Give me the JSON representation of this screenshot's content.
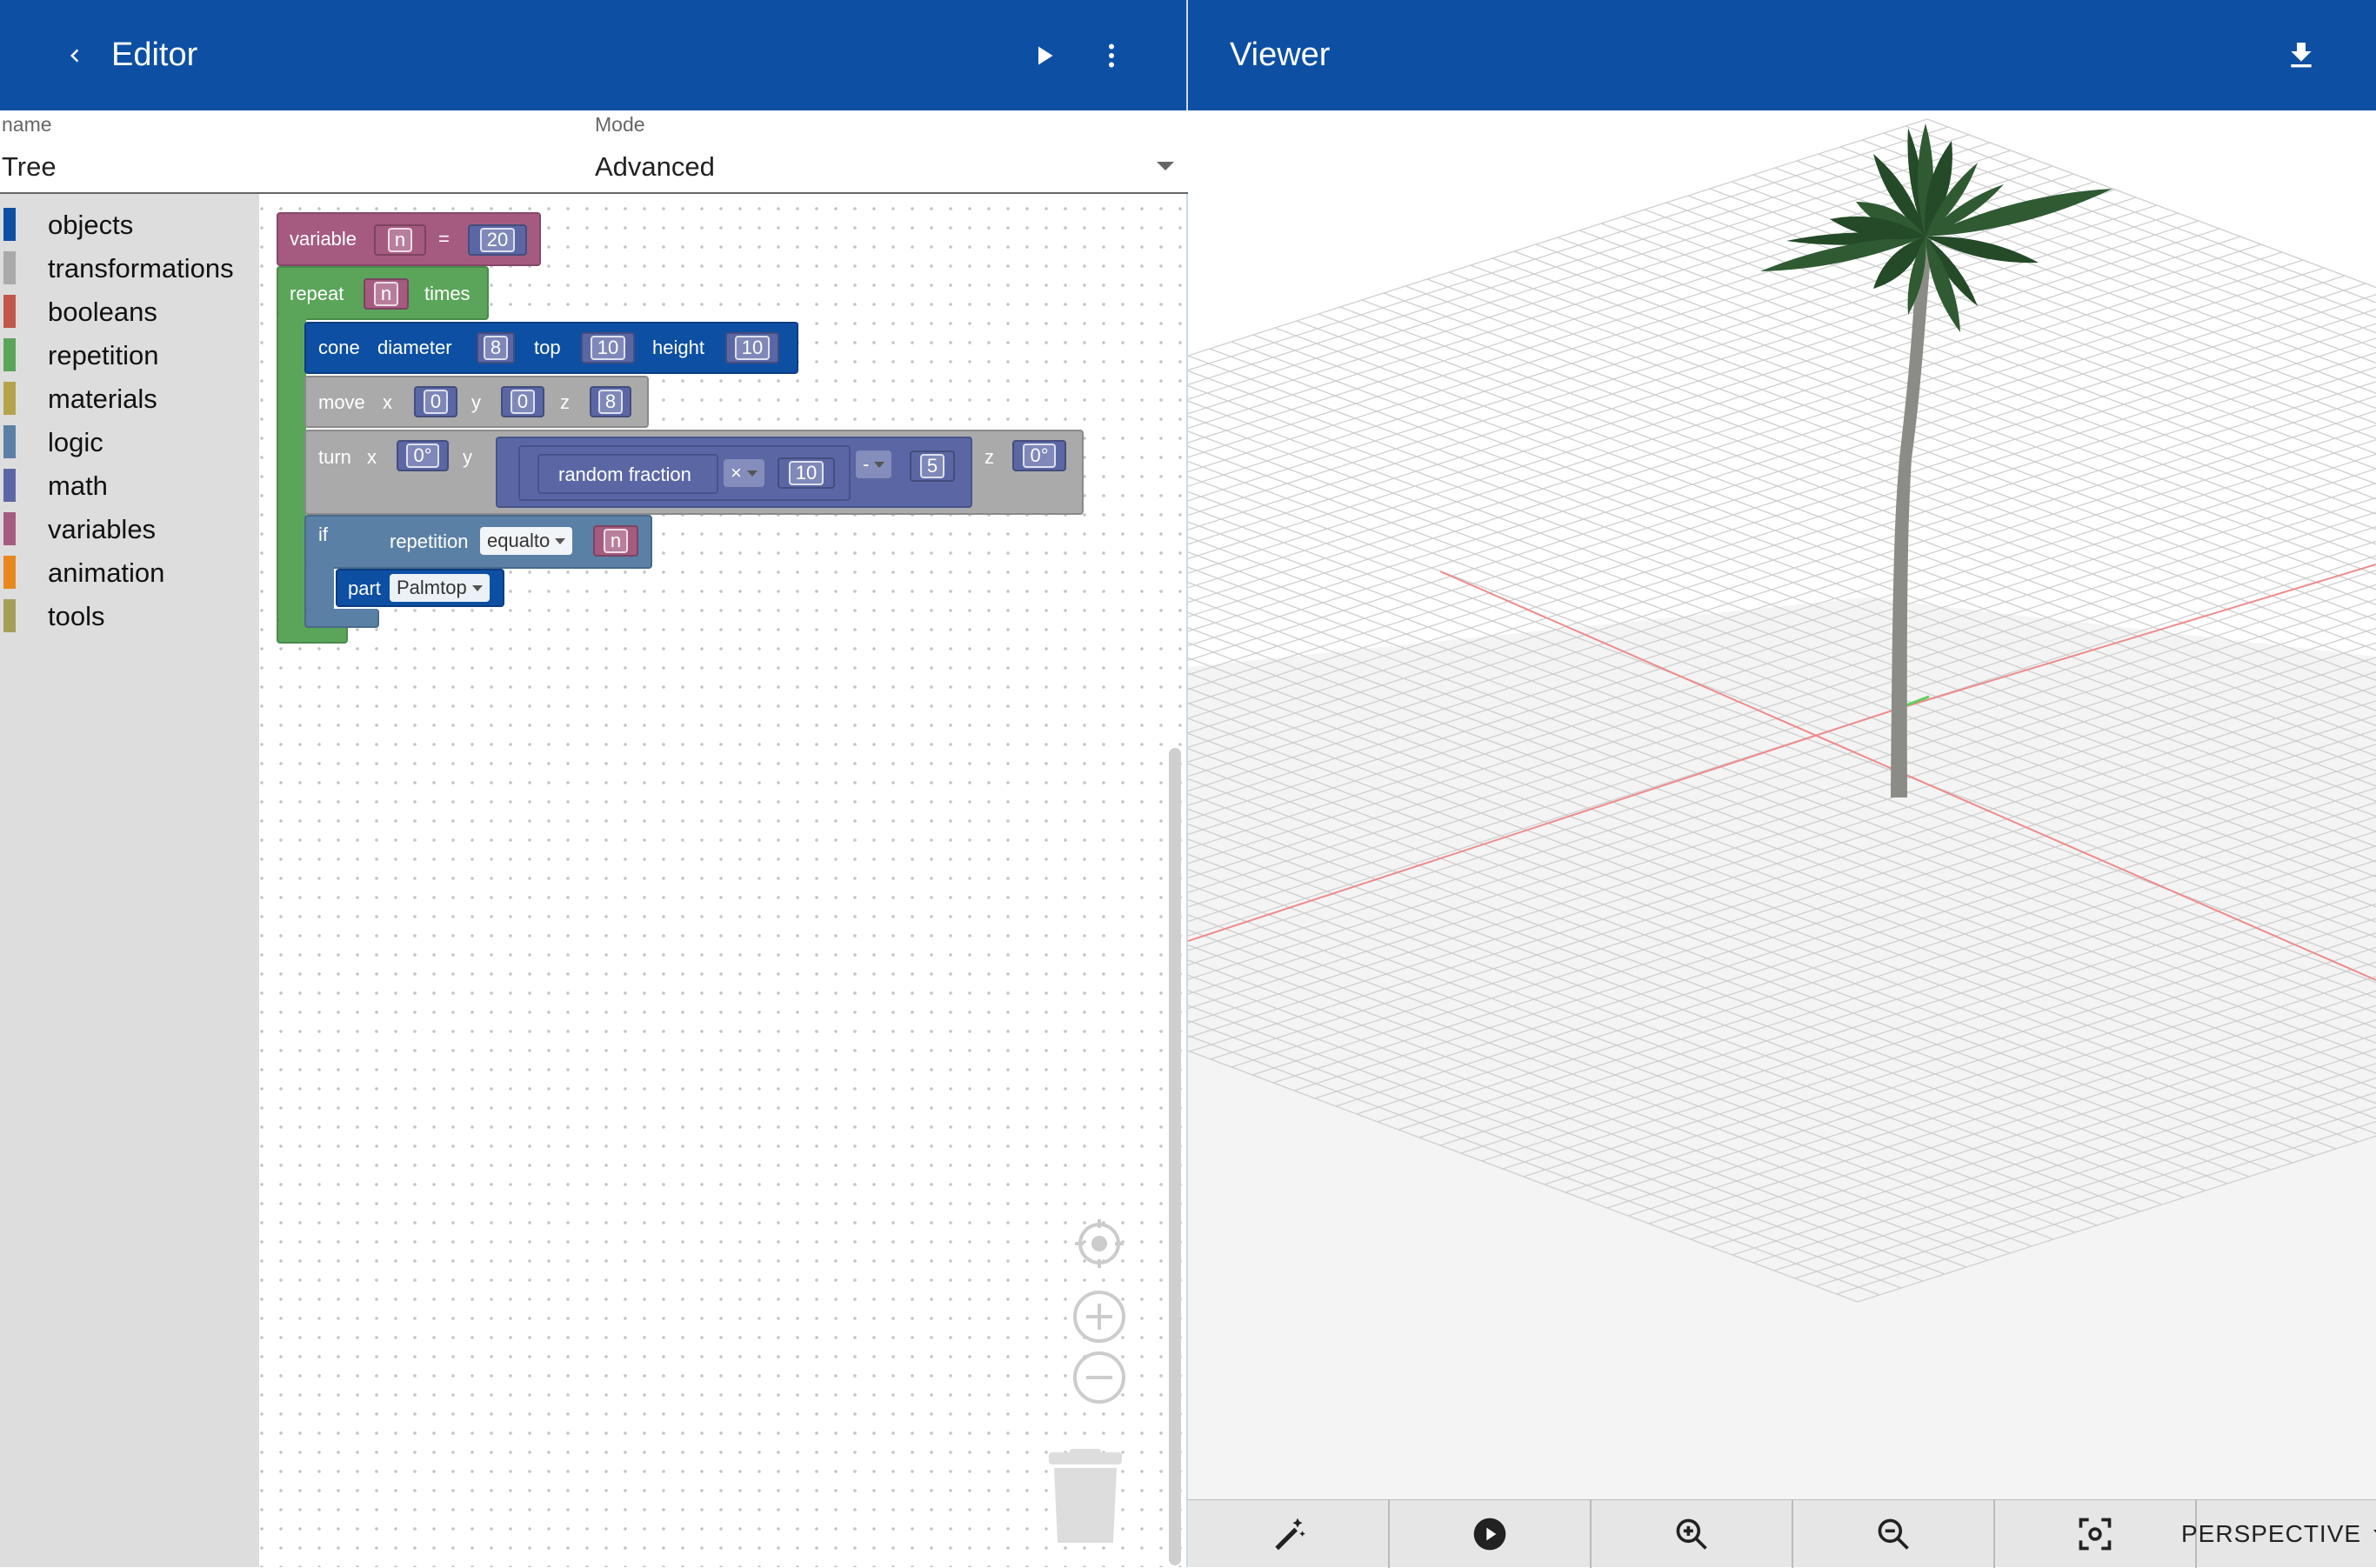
{
  "editor": {
    "back_icon": "chevron-left-icon",
    "title": "Editor",
    "run_icon": "play-icon",
    "menu_icon": "more-vert-icon"
  },
  "viewer": {
    "title": "Viewer",
    "download_icon": "download-icon"
  },
  "name_field": {
    "label": "name",
    "value": "Tree"
  },
  "mode_field": {
    "label": "Mode",
    "value": "Advanced"
  },
  "toolbox": {
    "categories": [
      {
        "label": "objects",
        "color": "#0d4fa3"
      },
      {
        "label": "transformations",
        "color": "#aaaaaa"
      },
      {
        "label": "booleans",
        "color": "#c1574a"
      },
      {
        "label": "repetition",
        "color": "#5ba55b"
      },
      {
        "label": "materials",
        "color": "#b5a34b"
      },
      {
        "label": "logic",
        "color": "#5b80a5"
      },
      {
        "label": "math",
        "color": "#5b67a5"
      },
      {
        "label": "variables",
        "color": "#a55b80"
      },
      {
        "label": "animation",
        "color": "#e9861d"
      },
      {
        "label": "tools",
        "color": "#a59e5b"
      }
    ]
  },
  "blocks": {
    "variable": {
      "keyword": "variable",
      "name": "n",
      "eq": "=",
      "value": "20"
    },
    "repeat": {
      "keyword": "repeat",
      "count": "n",
      "suffix": "times"
    },
    "cone": {
      "keyword": "cone",
      "diameter_label": "diameter",
      "diameter": "8",
      "top_label": "top",
      "top": "10",
      "height_label": "height",
      "height": "10"
    },
    "move": {
      "keyword": "move",
      "x_label": "x",
      "x": "0",
      "y_label": "y",
      "y": "0",
      "z_label": "z",
      "z": "8"
    },
    "turn": {
      "keyword": "turn",
      "x_label": "x",
      "x": "0°",
      "y_label": "y",
      "random": "random fraction",
      "op1": "×",
      "v1": "10",
      "op2": "-",
      "v2": "5",
      "z_label": "z",
      "z": "0°"
    },
    "if": {
      "keyword": "if",
      "repetition": "repetition",
      "cmp": "equalto",
      "var": "n"
    },
    "part": {
      "keyword": "part",
      "name": "Palmtop"
    }
  },
  "workspace_controls": {
    "center_icon": "recenter-icon",
    "zoom_in_icon": "zoom-in-icon",
    "zoom_out_icon": "zoom-out-icon",
    "trash_icon": "trash-icon"
  },
  "viewer_toolbar": {
    "tools": [
      "magic-wand-icon",
      "play-circle-icon",
      "zoom-in-icon",
      "zoom-out-icon",
      "fit-screen-icon"
    ],
    "camera_mode": "PERSPECTIVE"
  },
  "colors": {
    "app_bar": "#0d4fa3",
    "variables": "#a55b80",
    "repetition": "#5ba55b",
    "objects": "#0d4fa3",
    "transformations": "#aaaaaa",
    "logic": "#5b80a5",
    "math": "#5b67a5"
  }
}
